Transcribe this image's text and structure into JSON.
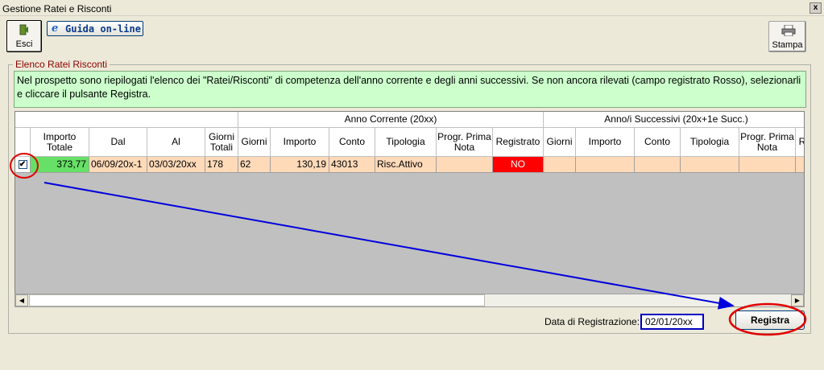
{
  "window": {
    "title": "Gestione Ratei e Risconti",
    "close_label": "x"
  },
  "toolbar": {
    "esci_label": "Esci",
    "guida_icon": "e",
    "guida_label": "Guida on-line",
    "stampa_label": "Stampa"
  },
  "section": {
    "title": "Elenco Ratei Risconti",
    "info": "Nel prospetto sono riepilogati l'elenco dei \"Ratei/Risconti\" di competenza dell'anno corrente e degli anni successivi. Se non ancora rilevati (campo registrato Rosso), selezionarli e cliccare il pulsante Registra."
  },
  "grid": {
    "group_headers": {
      "corrente": "Anno Corrente (20xx)",
      "successivi": "Anno/i Successivi (20x+1e Succ.)"
    },
    "columns": [
      "Importo Totale",
      "Dal",
      "Al",
      "Giorni Totali",
      "Giorni",
      "Importo",
      "Conto",
      "Tipologia",
      "Progr. Prima Nota",
      "Registrato",
      "Giorni",
      "Importo",
      "Conto",
      "Tipologia",
      "Progr. Prima Nota",
      "R"
    ],
    "rows": [
      {
        "checked": "✔",
        "importo_totale": "373,77",
        "dal": "06/09/20x-1",
        "al": "03/03/20xx",
        "giorni_totali": "178",
        "giorni": "62",
        "importo": "130,19",
        "conto": "43013",
        "tipologia": "Risc.Attivo",
        "progr": "",
        "registrato": "NO"
      }
    ]
  },
  "footer": {
    "date_label": "Data di Registrazione:",
    "date_value": "02/01/20xx",
    "registra_label": "Registra"
  },
  "scroll": {
    "left_arrow": "◀",
    "right_arrow": "▶"
  },
  "colors": {
    "info_bg": "#ccffcc",
    "row_bg": "#ffdab9",
    "green": "#66e066",
    "red": "#ff0000",
    "annotation_red": "#e00000",
    "annotation_blue": "#0000dd"
  }
}
